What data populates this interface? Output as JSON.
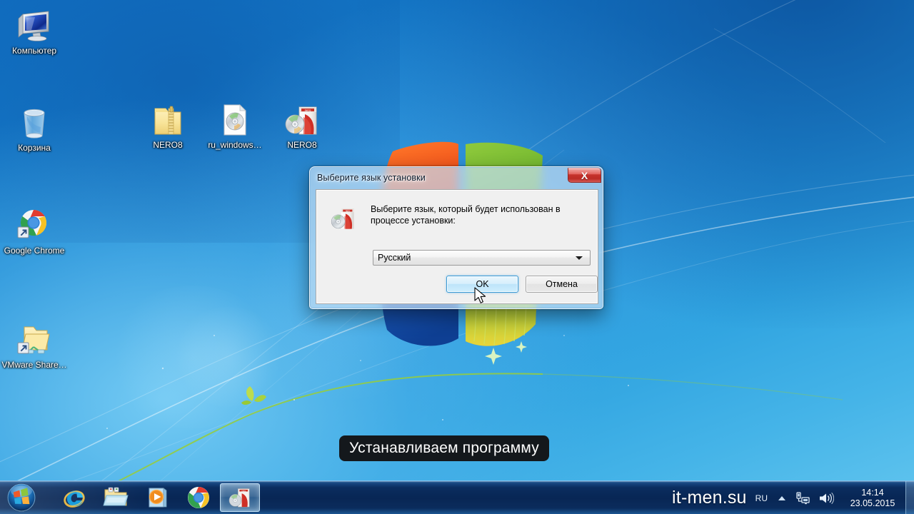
{
  "desktop": {
    "icons": [
      {
        "label": "Компьютер",
        "icon": "computer-icon"
      },
      {
        "label": "Корзина",
        "icon": "recycle-bin-icon"
      },
      {
        "label": "NERO8",
        "icon": "zip-folder-icon"
      },
      {
        "label": "ru_windows…",
        "icon": "disc-image-file-icon"
      },
      {
        "label": "NERO8",
        "icon": "nero-setup-icon"
      },
      {
        "label": "Google Chrome",
        "icon": "chrome-shortcut-icon"
      },
      {
        "label": "VMware Share…",
        "icon": "folder-shortcut-icon"
      }
    ]
  },
  "dialog": {
    "title": "Выберите язык установки",
    "icon": "nero-box-icon",
    "close_label": "X",
    "message": "Выберите язык, который будет использован в процессе установки:",
    "language_value": "Русский",
    "ok_label": "OK",
    "cancel_label": "Отмена"
  },
  "caption": {
    "text": "Устанавливаем программу"
  },
  "taskbar": {
    "start_label": "Пуск",
    "buttons": [
      {
        "name": "internet-explorer",
        "icon": "internet-explorer-icon",
        "active": false
      },
      {
        "name": "windows-explorer",
        "icon": "folder-icon",
        "active": false
      },
      {
        "name": "windows-media-player",
        "icon": "media-player-icon",
        "active": false
      },
      {
        "name": "google-chrome",
        "icon": "chrome-icon",
        "active": false
      },
      {
        "name": "nero-setup",
        "icon": "nero-box-icon",
        "active": true
      }
    ],
    "watermark": "it-men.su",
    "language": "RU",
    "tray_icons": [
      "show-hidden-icons-arrow",
      "network-icon",
      "volume-icon"
    ],
    "clock_time": "14:14",
    "clock_date": "23.05.2015"
  },
  "colors": {
    "accent_blue": "#1a84d0",
    "taskbar_blue": "#0a2a5c",
    "close_red": "#c6332d",
    "ok_focus_blue": "#3c9ad4",
    "caption_bg": "#14181c"
  }
}
